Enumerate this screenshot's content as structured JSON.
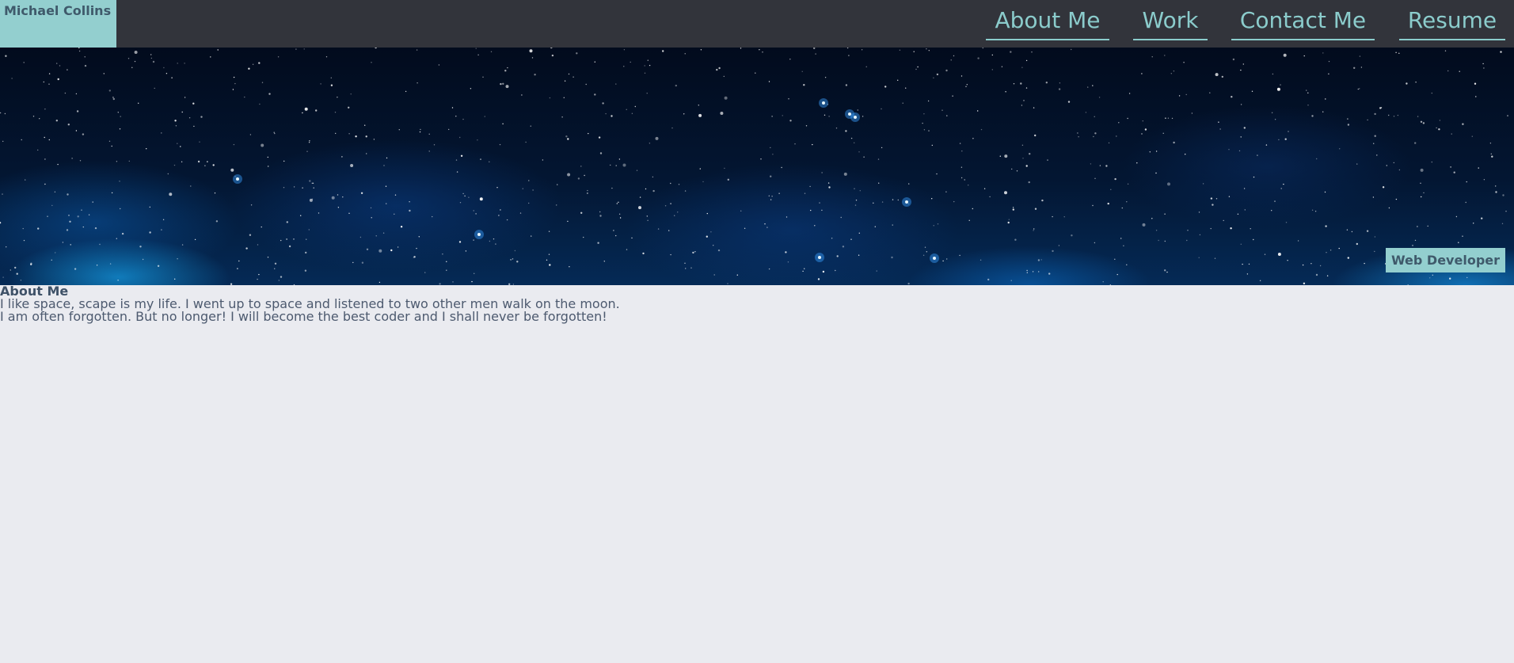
{
  "header": {
    "brand_name": "Michael Collins",
    "nav": [
      {
        "label": "About Me"
      },
      {
        "label": "Work"
      },
      {
        "label": "Contact Me"
      },
      {
        "label": "Resume"
      }
    ]
  },
  "hero": {
    "image": "starfield-space-background",
    "badge": "Web Developer"
  },
  "about": {
    "title": "About Me",
    "lines": [
      "I like space, scape is my life. I went up to space and listened to two other men walk on the moon.",
      "I am often forgotten. But no longer! I will become the best coder and I shall never be forgotten!"
    ]
  },
  "colors": {
    "header_bg": "#32343b",
    "accent": "#93cfcf",
    "page_bg": "#eaebf0",
    "text": "#4d5a6f"
  }
}
